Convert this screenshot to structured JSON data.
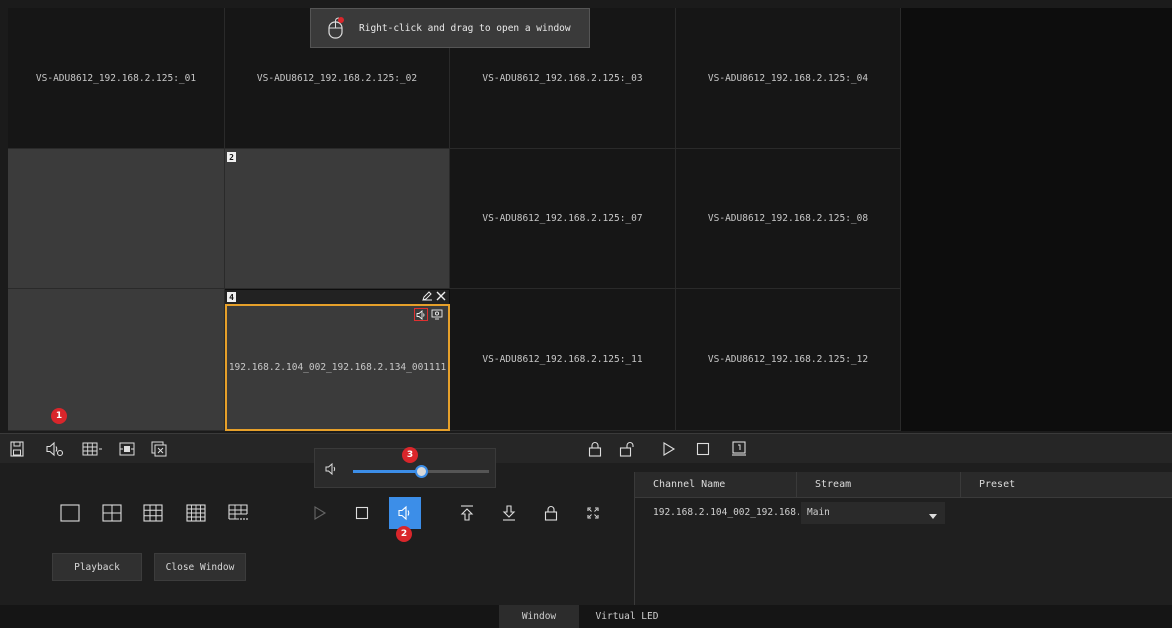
{
  "hint": {
    "text": "Right-click and drag to open a window"
  },
  "tiles": {
    "t01": "VS-ADU8612_192.168.2.125:_01",
    "t02": "VS-ADU8612_192.168.2.125:_02",
    "t03": "VS-ADU8612_192.168.2.125:_03",
    "t04": "VS-ADU8612_192.168.2.125:_04",
    "t07": "VS-ADU8612_192.168.2.125:_07",
    "t08": "VS-ADU8612_192.168.2.125:_08",
    "t11": "VS-ADU8612_192.168.2.125:_11",
    "t12": "VS-ADU8612_192.168.2.125:_12",
    "selected": "192.168.2.104_002_192.168.2.134_001111",
    "window2_number": "2",
    "window4_number": "4"
  },
  "badges": {
    "b1": "1",
    "b2": "2",
    "b3": "3"
  },
  "volume": {
    "level_percent": 50
  },
  "buttons": {
    "playback": "Playback",
    "close_window": "Close Window"
  },
  "table": {
    "headers": [
      "Channel Name",
      "Stream",
      "Preset"
    ],
    "rows": [
      {
        "channel": "192.168.2.104_002_192.168.2",
        "stream": "Main",
        "preset": ""
      }
    ]
  },
  "tabs": {
    "window": "Window",
    "virtual_led": "Virtual LED"
  },
  "colors": {
    "accent": "#3c8ee8",
    "selected_border": "#e6a02a",
    "badge": "#d9262b"
  }
}
